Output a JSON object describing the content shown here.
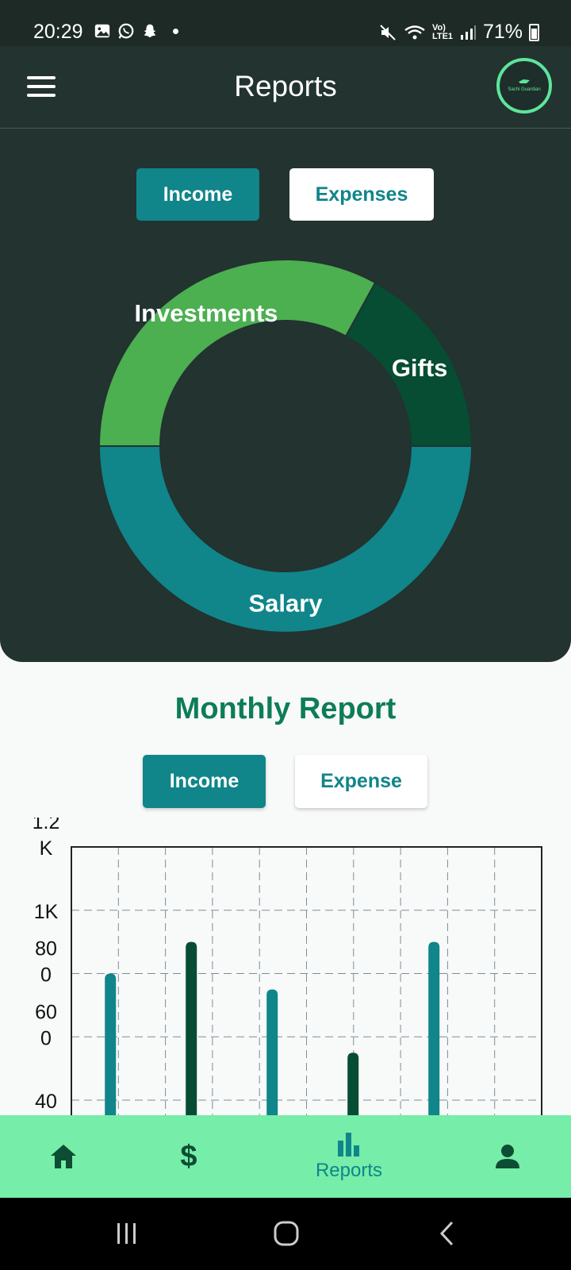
{
  "status_bar": {
    "time": "20:29",
    "battery": "71%",
    "network_label": "Vo) LTE1"
  },
  "header": {
    "title": "Reports",
    "logo_text": "Sachi Guardian"
  },
  "top_toggle": {
    "income_label": "Income",
    "expenses_label": "Expenses",
    "active": "income"
  },
  "donut": {
    "slices": [
      {
        "label": "Investments",
        "value": 0.33,
        "color": "#4caf50"
      },
      {
        "label": "Gifts",
        "value": 0.17,
        "color": "#064d33"
      },
      {
        "label": "Salary",
        "value": 0.5,
        "color": "#10858a"
      }
    ]
  },
  "monthly": {
    "title": "Monthly Report",
    "income_label": "Income",
    "expense_label": "Expense",
    "active": "income"
  },
  "chart_data": {
    "type": "bar",
    "y_ticks": [
      {
        "lines": [
          "1.2",
          "K"
        ],
        "value": 1200
      },
      {
        "lines": [
          "1K"
        ],
        "value": 1000
      },
      {
        "lines": [
          "80",
          "0"
        ],
        "value": 800
      },
      {
        "lines": [
          "60",
          "0"
        ],
        "value": 600
      },
      {
        "lines": [
          "40"
        ],
        "value": 400
      }
    ],
    "ylim": [
      350,
      1200
    ],
    "values": [
      800,
      900,
      750,
      550,
      900
    ],
    "bar_colors": [
      "#10858a",
      "#064d33",
      "#10858a",
      "#064d33",
      "#10858a"
    ],
    "grid": true
  },
  "bottom_nav": {
    "reports_label": "Reports",
    "money_symbol": "$"
  },
  "colors": {
    "dark_bg": "#223330",
    "accent_teal": "#10858a",
    "accent_green": "#0d7d57",
    "nav_bg": "#76eda9"
  }
}
